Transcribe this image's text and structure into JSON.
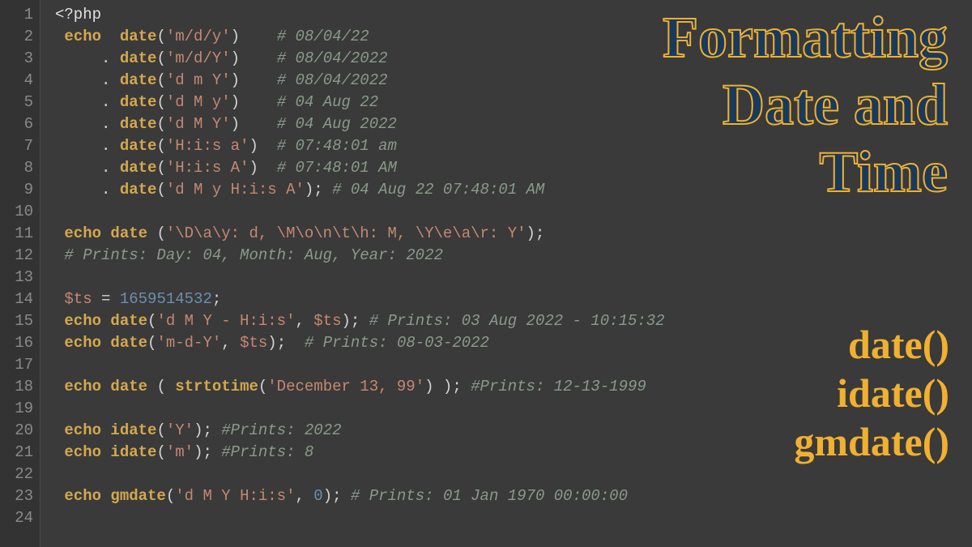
{
  "title_lines": [
    "Formatting",
    "Date and",
    "Time"
  ],
  "side_functions": [
    "date()",
    "idate()",
    "gmdate()"
  ],
  "line_numbers": [
    "1",
    "2",
    "3",
    "4",
    "5",
    "6",
    "7",
    "8",
    "9",
    "10",
    "11",
    "12",
    "13",
    "14",
    "15",
    "16",
    "17",
    "18",
    "19",
    "20",
    "21",
    "22",
    "23",
    "24"
  ],
  "code": {
    "l1": {
      "open": "<?php"
    },
    "l2": {
      "echo": "echo",
      "func": "date",
      "arg": "'m/d/y'",
      "cmt": "# 08/04/22"
    },
    "l3": {
      "func": "date",
      "arg": "'m/d/Y'",
      "cmt": "# 08/04/2022"
    },
    "l4": {
      "func": "date",
      "arg": "'d m Y'",
      "cmt": "# 08/04/2022"
    },
    "l5": {
      "func": "date",
      "arg": "'d M y'",
      "cmt": "# 04 Aug 22"
    },
    "l6": {
      "func": "date",
      "arg": "'d M Y'",
      "cmt": "# 04 Aug 2022"
    },
    "l7": {
      "func": "date",
      "arg": "'H:i:s a'",
      "cmt": "# 07:48:01 am"
    },
    "l8": {
      "func": "date",
      "arg": "'H:i:s A'",
      "cmt": "# 07:48:01 AM"
    },
    "l9": {
      "func": "date",
      "arg": "'d M y H:i:s A'",
      "cmt": "# 04 Aug 22 07:48:01 AM"
    },
    "l11": {
      "echo": "echo",
      "func": "date",
      "arg": "'\\D\\a\\y: d, \\M\\o\\n\\t\\h: M, \\Y\\e\\a\\r: Y'"
    },
    "l12": {
      "cmt": "# Prints: Day: 04, Month: Aug, Year: 2022"
    },
    "l14": {
      "var": "$ts",
      "num": "1659514532"
    },
    "l15": {
      "echo": "echo",
      "func": "date",
      "arg": "'d M Y - H:i:s'",
      "var": "$ts",
      "cmt": "# Prints: 03 Aug 2022 - 10:15:32"
    },
    "l16": {
      "echo": "echo",
      "func": "date",
      "arg": "'m-d-Y'",
      "var": "$ts",
      "cmt": "# Prints: 08-03-2022"
    },
    "l18": {
      "echo": "echo",
      "func": "date",
      "func2": "strtotime",
      "arg": "'December 13, 99'",
      "cmt": "#Prints: 12-13-1999"
    },
    "l20": {
      "echo": "echo",
      "func": "idate",
      "arg": "'Y'",
      "cmt": "#Prints: 2022"
    },
    "l21": {
      "echo": "echo",
      "func": "idate",
      "arg": "'m'",
      "cmt": "#Prints: 8"
    },
    "l23": {
      "echo": "echo",
      "func": "gmdate",
      "arg": "'d M Y H:i:s'",
      "num": "0",
      "cmt": "# Prints: 01 Jan 1970 00:00:00"
    }
  }
}
